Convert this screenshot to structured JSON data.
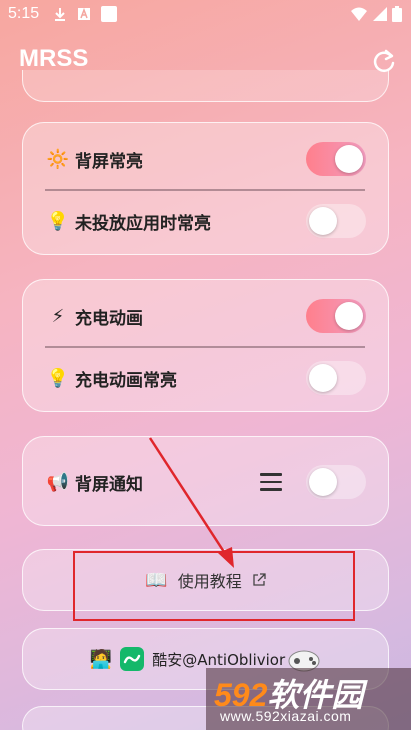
{
  "status_bar": {
    "time": "5:15",
    "left_icons": [
      "download-icon",
      "a-box-icon",
      "square-icon"
    ],
    "right_icons": [
      "wifi-icon",
      "signal-icon",
      "battery-icon"
    ]
  },
  "app_bar": {
    "title": "MRSS",
    "refresh_icon": "refresh-icon"
  },
  "cards": [
    {
      "rows": [
        {
          "emoji": "🔆",
          "label": "背屏常亮",
          "toggle_on": true
        },
        {
          "emoji": "💡",
          "label": "未投放应用时常亮",
          "toggle_on": false
        }
      ]
    },
    {
      "rows": [
        {
          "emoji": "⚡",
          "label": "充电动画",
          "toggle_on": true
        },
        {
          "emoji": "💡",
          "label": "充电动画常亮",
          "toggle_on": false
        }
      ]
    },
    {
      "rows": [
        {
          "emoji": "📢",
          "label": "背屏通知",
          "toggle_on": false
        }
      ]
    }
  ],
  "tutorial": {
    "emoji": "📖",
    "label": "使用教程"
  },
  "author": {
    "emoji": "🧑‍💻",
    "label": "酷安@AntiOblivior"
  },
  "watermark": {
    "brand_num": "592",
    "brand_text": "软件园",
    "url": "www.592xiazai.com"
  },
  "colors": {
    "toggle_on": "#ff7f8c",
    "annotation_red": "#e0262c"
  }
}
